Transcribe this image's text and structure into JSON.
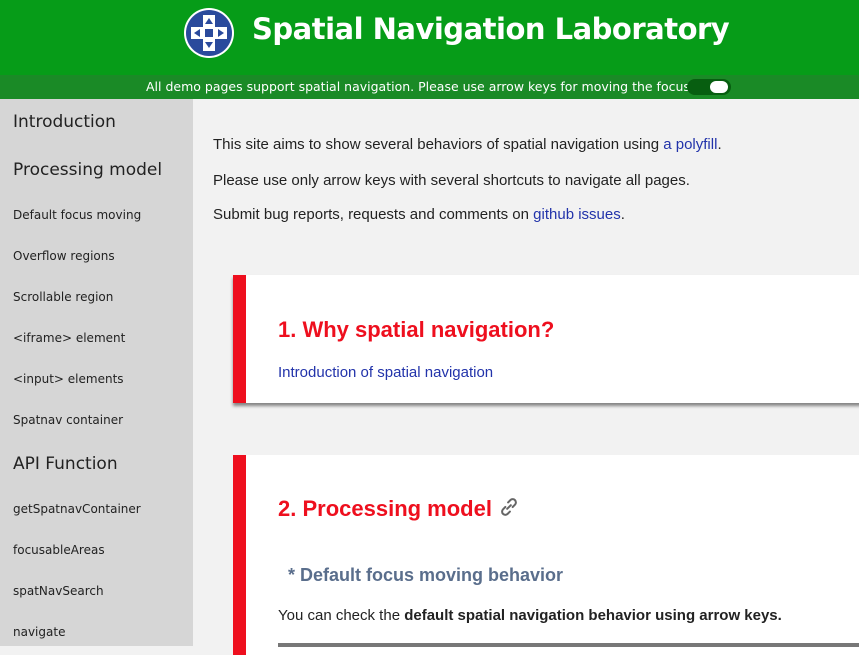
{
  "header": {
    "title": "Spatial Navigation Laboratory",
    "logo_icon": "dpad-icon",
    "background": "#069c18"
  },
  "notice": {
    "text": "All demo pages support spatial navigation. Please use arrow keys for moving the focus.",
    "toggle_state": "on"
  },
  "sidebar": {
    "items": [
      {
        "label": "Introduction",
        "size": "large"
      },
      {
        "label": "Processing model",
        "size": "large"
      },
      {
        "label": "Default focus moving",
        "size": "small"
      },
      {
        "label": "Overflow regions",
        "size": "small"
      },
      {
        "label": "Scrollable region",
        "size": "small"
      },
      {
        "label": "<iframe> element",
        "size": "small"
      },
      {
        "label": "<input> elements",
        "size": "small"
      },
      {
        "label": "Spatnav container",
        "size": "small"
      },
      {
        "label": "API Function",
        "size": "large"
      },
      {
        "label": "getSpatnavContainer",
        "size": "small"
      },
      {
        "label": "focusableAreas",
        "size": "small"
      },
      {
        "label": "spatNavSearch",
        "size": "small"
      },
      {
        "label": "navigate",
        "size": "small"
      }
    ]
  },
  "intro": {
    "line1_prefix": "This site aims to show several behaviors of spatial navigation using ",
    "line1_link": "a polyfill",
    "line1_suffix": ".",
    "line2": "Please use only arrow keys with several shortcuts to navigate all pages.",
    "line3_prefix": "Submit bug reports, requests and comments on ",
    "line3_link": "github issues",
    "line3_suffix": "."
  },
  "sections": [
    {
      "title": "1. Why spatial navigation?",
      "link": "Introduction of spatial navigation"
    },
    {
      "title": "2. Processing model",
      "link_icon": "link-chain-icon",
      "subheading": "* Default focus moving behavior",
      "desc_prefix": "You can check the ",
      "desc_bold": "default spatial navigation behavior using arrow keys."
    }
  ],
  "colors": {
    "accent_red": "#ee0f1e",
    "link_blue": "#2233aa",
    "sidebar_bg": "#d6d6d6"
  }
}
